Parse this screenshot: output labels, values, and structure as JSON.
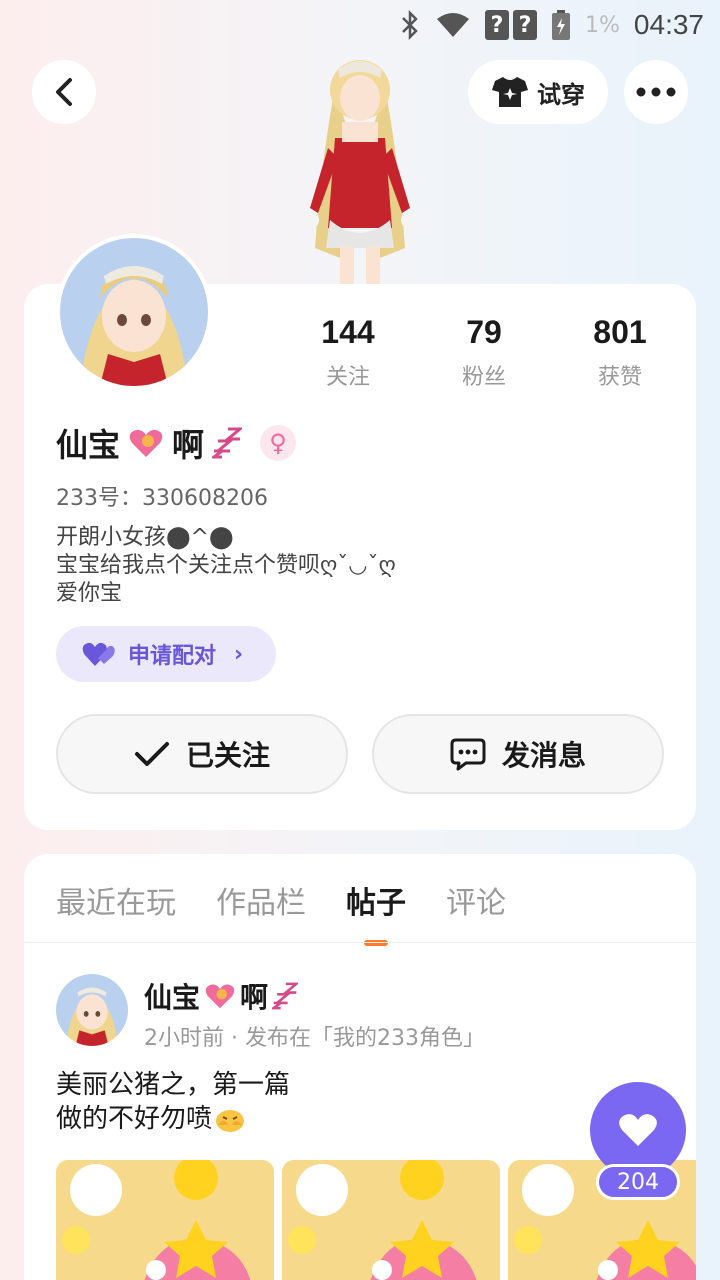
{
  "status_bar": {
    "battery": "1%",
    "time": "04:37"
  },
  "header": {
    "try_on_label": "试穿"
  },
  "profile": {
    "name": "仙宝",
    "name_suffix": "啊",
    "uid": "233号：330608206",
    "bio_lines": [
      "开朗小女孩⬤^⬤",
      "宝宝给我点个关注点个赞呗ღˇ◡ˇღ",
      "爱你宝"
    ],
    "pair_label": "申请配对",
    "stats": [
      {
        "value": "144",
        "label": "关注"
      },
      {
        "value": "79",
        "label": "粉丝"
      },
      {
        "value": "801",
        "label": "获赞"
      }
    ],
    "followed_label": "已关注",
    "message_label": "发消息"
  },
  "tabs": [
    {
      "label": "最近在玩",
      "active": false
    },
    {
      "label": "作品栏",
      "active": false
    },
    {
      "label": "帖子",
      "active": true
    },
    {
      "label": "评论",
      "active": false
    }
  ],
  "post": {
    "author": "仙宝",
    "author_suffix": "啊",
    "meta": "2小时前 · 发布在「我的233角色」",
    "text_line1": "美丽公猪之，第一篇",
    "text_line2": "做的不好勿喷"
  },
  "like_count": "204",
  "colors": {
    "accent": "#7a67f2",
    "tab_indicator": "#ff7a2a",
    "pair_bg": "#ebe8fb"
  }
}
